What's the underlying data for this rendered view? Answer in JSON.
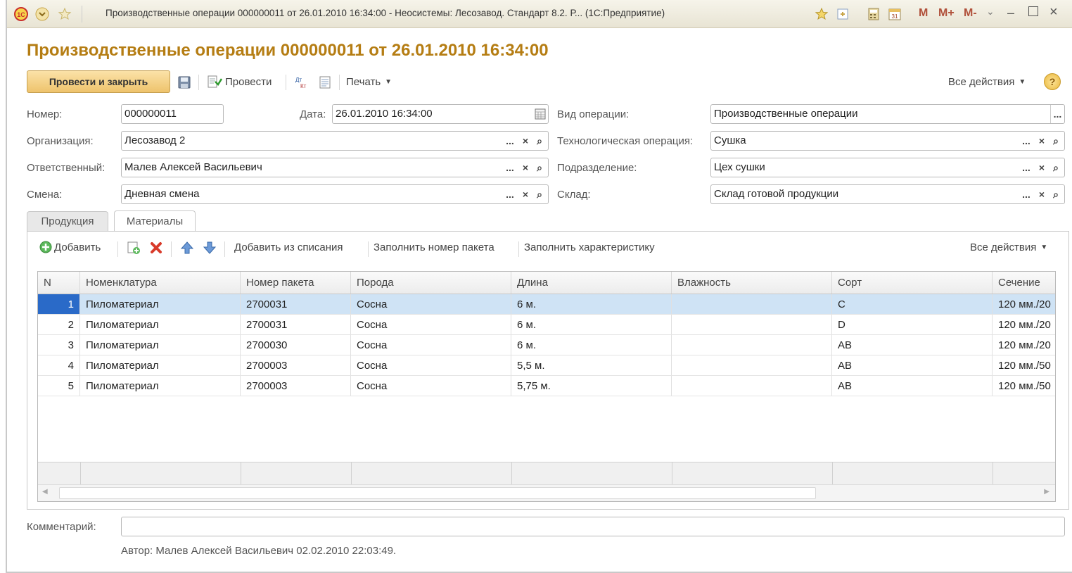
{
  "window": {
    "title": "Производственные операции 000000011 от 26.01.2010 16:34:00 - Неосистемы: Лесозавод. Стандарт 8.2. Р... (1С:Предприятие)",
    "memory_buttons": [
      "M",
      "M+",
      "M-"
    ]
  },
  "document": {
    "title": "Производственные операции 000000011 от 26.01.2010 16:34:00"
  },
  "toolbar": {
    "post_close": "Провести и закрыть",
    "post": "Провести",
    "print": "Печать",
    "all_actions": "Все действия",
    "help": "?"
  },
  "form": {
    "number_label": "Номер:",
    "number_value": "000000011",
    "date_label": "Дата:",
    "date_value": "26.01.2010 16:34:00",
    "op_type_label": "Вид операции:",
    "op_type_value": "Производственные операции",
    "org_label": "Организация:",
    "org_value": "Лесозавод 2",
    "tech_op_label": "Технологическая операция:",
    "tech_op_value": "Сушка",
    "resp_label": "Ответственный:",
    "resp_value": "Малев Алексей Васильевич",
    "division_label": "Подразделение:",
    "division_value": "Цех сушки",
    "shift_label": "Смена:",
    "shift_value": "Дневная смена",
    "warehouse_label": "Склад:",
    "warehouse_value": "Склад готовой продукции"
  },
  "tabs": [
    "Продукция",
    "Материалы"
  ],
  "active_tab": "Материалы",
  "table_toolbar": {
    "add": "Добавить",
    "add_from_writeoff": "Добавить из списания",
    "fill_package": "Заполнить номер пакета",
    "fill_characteristic": "Заполнить характеристику",
    "all_actions": "Все действия"
  },
  "table": {
    "columns": [
      "N",
      "Номенклатура",
      "Номер пакета",
      "Порода",
      "Длина",
      "Влажность",
      "Сорт",
      "Сечение"
    ],
    "rows": [
      [
        "1",
        "Пиломатериал",
        "2700031",
        "Сосна",
        "6 м.",
        "",
        "C",
        "120 мм./20"
      ],
      [
        "2",
        "Пиломатериал",
        "2700031",
        "Сосна",
        "6 м.",
        "",
        "D",
        "120 мм./20"
      ],
      [
        "3",
        "Пиломатериал",
        "2700030",
        "Сосна",
        "6 м.",
        "",
        "AB",
        "120 мм./20"
      ],
      [
        "4",
        "Пиломатериал",
        "2700003",
        "Сосна",
        "5,5 м.",
        "",
        "AB",
        "120 мм./50"
      ],
      [
        "5",
        "Пиломатериал",
        "2700003",
        "Сосна",
        "5,75 м.",
        "",
        "AB",
        "120 мм./50"
      ]
    ]
  },
  "comment_label": "Комментарий:",
  "comment_value": "",
  "author": "Автор: Малев Алексей Васильевич 02.02.2010 22:03:49.",
  "colors": {
    "accent": "#b57d13",
    "selected_row": "#cfe3f5",
    "primary_button": "#eec36c"
  }
}
